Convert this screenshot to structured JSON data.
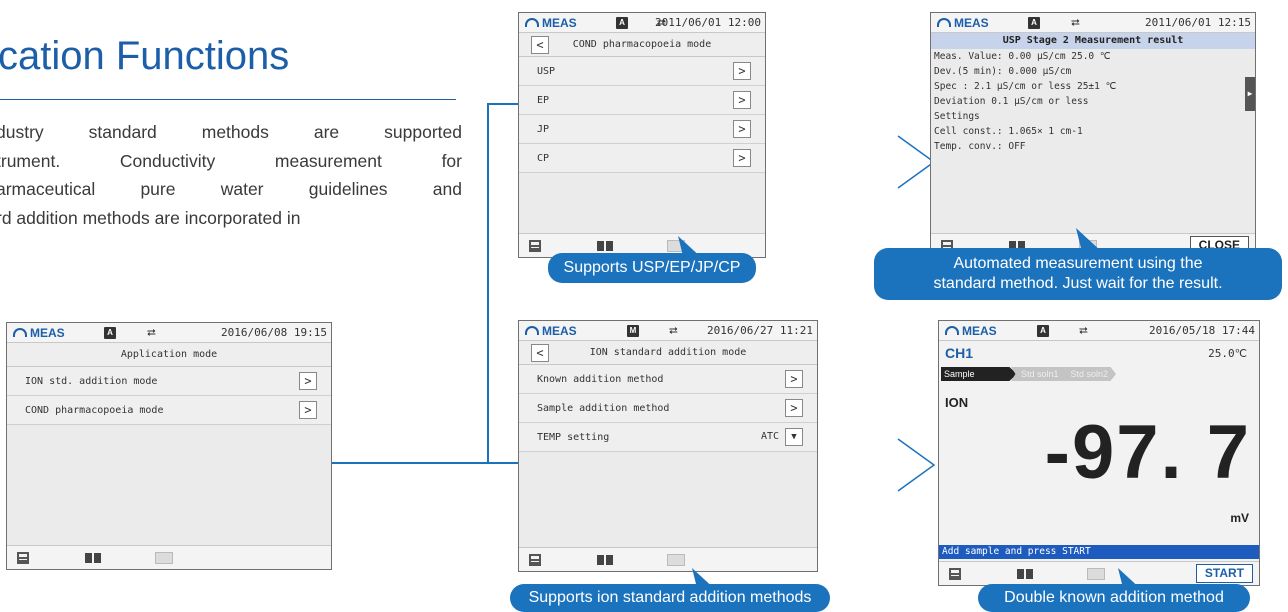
{
  "page": {
    "title": "cation Functions",
    "intro_lines": [
      "dustry standard methods are supported",
      "trument. Conductivity measurement for",
      "armaceutical pure water guidelines and",
      "rd addition methods are incorporated in"
    ]
  },
  "colors": {
    "brand_blue": "#1c5fa8",
    "callout_blue": "#1c73bd",
    "msg_bar_blue": "#1e5bbf"
  },
  "screens": {
    "app_mode": {
      "status": {
        "mode": "MEAS",
        "lock_glyph": "A",
        "datetime": "2016/06/08 19:15"
      },
      "header": "Application mode",
      "items": [
        {
          "label": "ION std. addition mode",
          "arrow": ">"
        },
        {
          "label": "COND pharmacopoeia mode",
          "arrow": ">"
        }
      ]
    },
    "cond_mode": {
      "status": {
        "mode": "MEAS",
        "lock_glyph": "A",
        "datetime": "2011/06/01 12:00"
      },
      "back": "<",
      "header": "COND pharmacopoeia mode",
      "items": [
        {
          "label": "USP",
          "arrow": ">"
        },
        {
          "label": "EP",
          "arrow": ">"
        },
        {
          "label": "JP",
          "arrow": ">"
        },
        {
          "label": "CP",
          "arrow": ">"
        }
      ]
    },
    "usp_result": {
      "status": {
        "mode": "MEAS",
        "lock_glyph": "A",
        "datetime": "2011/06/01 12:15"
      },
      "title": "USP Stage 2 Measurement result",
      "lines": [
        "Meas. Value:    0.00 µS/cm              25.0 ℃",
        "Dev.(5 min):   0.000 µS/cm",
        "Spec          :        2.1 µS/cm or less  25±1 ℃",
        "                   Deviation  0.1  µS/cm or less",
        "Settings",
        "Cell const.:    1.065×    1  cm-1",
        "Temp. conv.: OFF"
      ],
      "close_label": "CLOSE"
    },
    "ion_mode": {
      "status": {
        "mode": "MEAS",
        "lock_glyph": "M",
        "datetime": "2016/06/27 11:21"
      },
      "back": "<",
      "header": "ION standard addition mode",
      "items": [
        {
          "label": "Known addition method",
          "arrow": ">"
        },
        {
          "label": "Sample addition method",
          "arrow": ">"
        }
      ],
      "temp": {
        "label": "TEMP setting",
        "value": "ATC",
        "dropdown": "▼"
      }
    },
    "ion_measure": {
      "status": {
        "mode": "MEAS",
        "lock_glyph": "A",
        "datetime": "2016/05/18 17:44"
      },
      "channel": "CH1",
      "temperature": "25.0℃",
      "steps": [
        "Sample",
        "Std soln1",
        "Std soln2"
      ],
      "param": "ION",
      "value": "-97. 7",
      "unit": "mV",
      "message": "Add sample and press START",
      "start_label": "START"
    }
  },
  "callouts": {
    "usp": "Supports USP/EP/JP/CP",
    "auto_line1": "Automated measurement using the",
    "auto_line2": "standard method. Just wait for the result.",
    "ion": "Supports ion standard addition methods",
    "double": "Double known addition method"
  }
}
